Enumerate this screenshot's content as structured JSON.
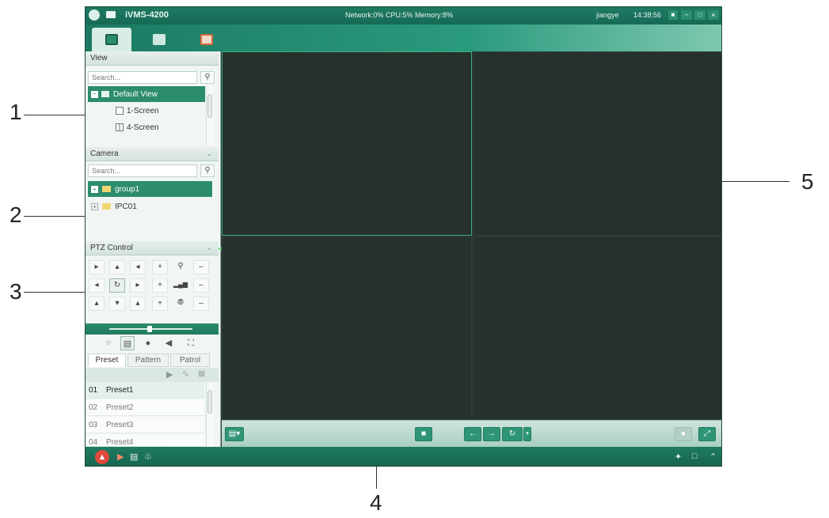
{
  "titlebar": {
    "app_name": "iVMS-4200",
    "status": "Network:0%  CPU:5%  Memory:8%",
    "user": "jiangye",
    "time": "14:38:56"
  },
  "view_panel": {
    "header": "View",
    "search_placeholder": "Search...",
    "items": [
      {
        "label": "Default View",
        "selected": true
      },
      {
        "label": "1-Screen"
      },
      {
        "label": "4-Screen"
      }
    ]
  },
  "camera_panel": {
    "header": "Camera",
    "search_placeholder": "Search...",
    "items": [
      {
        "label": "group1",
        "selected": true
      },
      {
        "label": "IPC01"
      }
    ]
  },
  "ptz_panel": {
    "header": "PTZ Control",
    "tabs": [
      "Preset",
      "Pattern",
      "Patrol"
    ],
    "presets": [
      {
        "num": "01",
        "label": "Preset1",
        "selected": true
      },
      {
        "num": "02",
        "label": "Preset2"
      },
      {
        "num": "03",
        "label": "Preset3"
      },
      {
        "num": "04",
        "label": "Preset4"
      }
    ]
  },
  "callouts": [
    "1",
    "2",
    "3",
    "4",
    "5"
  ],
  "colors": {
    "titlebar": "#1e7a63",
    "accent": "#2c8c6e",
    "video_bg": "#26302d",
    "active_cell_border": "#3fae7c"
  }
}
